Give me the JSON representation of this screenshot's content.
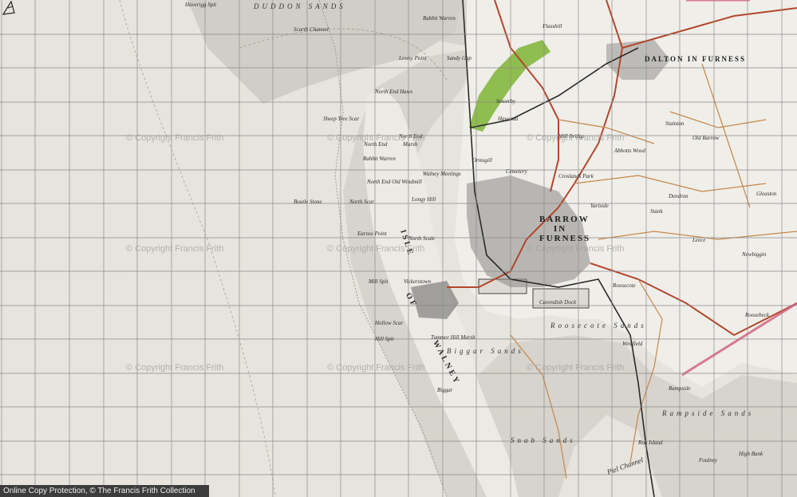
{
  "map": {
    "colors": {
      "sea": "#e6e4dc",
      "sand": "#d2d0c8",
      "land": "#efeee9",
      "grid": "#8a8a8a",
      "road_major": "#b3472c",
      "road_minor": "#c8874a",
      "railway": "#2a2a2a",
      "woodland": "#8fbd4f",
      "urban": "#5a5a5a"
    },
    "labels": {
      "haverigg_spit": "Haverigg Spit",
      "duddon_sands": "DUDDON SANDS",
      "scarth_channel": "Scarth Channel",
      "rabbit_warren_top": "Rabbit Warren",
      "lowsy_point": "Lowsy Point",
      "sandy_gap": "Sandy Gap",
      "north_end_haws": "North End Haws",
      "sheep_tree_scar": "Sheep Tree Scar",
      "north_end": "North End",
      "north_end_2": "North End",
      "marsh": "Marsh",
      "rabbit_warren": "Rabbit Warren",
      "north_end_old_windmill": "North End Old Windmill",
      "walney_meetings": "Walney Meetings",
      "north_scar": "North Scar",
      "bootle_stone": "Bootle Stone",
      "longy_hill": "Longy Hill",
      "earnse_point": "Earnse Point",
      "north_scale": "North Scale",
      "isle_of": "ISLE",
      "of": "OF",
      "walney": "WALNEY",
      "mill_spit": "Mill Spit",
      "vickerstown": "Vickerstown",
      "hollow_scar": "Hollow Scar",
      "hill_spit": "Hill Spit",
      "tummer_hill_marsh": "Tummer Hill Marsh",
      "biggar_sands": "Biggar Sands",
      "biggar": "Biggar",
      "snab_sands": "Snab Sands",
      "roosecote_sands": "Roosecote Sands",
      "rampside_sands": "Rampside Sands",
      "piel_channel": "Piel Channel",
      "dalton_in_furness": "DALTON IN FURNESS",
      "barrow": "BARROW",
      "in": "IN",
      "furness": "FURNESS",
      "ormsgill": "Ormsgill",
      "cemetery": "Cemetery",
      "croslands_park": "Croslands Park",
      "cavendish_dock": "Cavendish Dock",
      "roosecote": "Roosecote",
      "newbiggin": "Newbiggin",
      "rampside": "Rampside",
      "stank": "Stank",
      "dendron": "Dendron",
      "gleaston": "Gleaston",
      "roosebeck": "Roosebeck",
      "westfield": "Westfield",
      "high_bank": "High Bank",
      "roa_island": "Roa Island",
      "mill_bridge": "Mill Bridge",
      "old_barrow": "Old Barrow",
      "leece": "Leece",
      "stainton": "Stainton",
      "hawcoat": "Hawcoat",
      "sowerby": "Sowerby",
      "abbotts_wood": "Abbotts Wood",
      "yarlside": "Yarlside",
      "flasshill": "Flasshill",
      "foulney": "Foulney"
    },
    "watermarks": [
      "© Copyright Francis Frith",
      "© Copyright Francis Frith",
      "© Copyright Francis Frith",
      "© Copyright Francis Frith",
      "© Copyright Francis Frith",
      "© Copyright Francis Frith",
      "© Copyright Francis Frith",
      "© Copyright Francis Frith",
      "© Copyright Francis Frith"
    ],
    "footer": "Online Copy Protection, © The Francis Frith Collection",
    "north_arrow_icon": "north-arrow-icon"
  }
}
